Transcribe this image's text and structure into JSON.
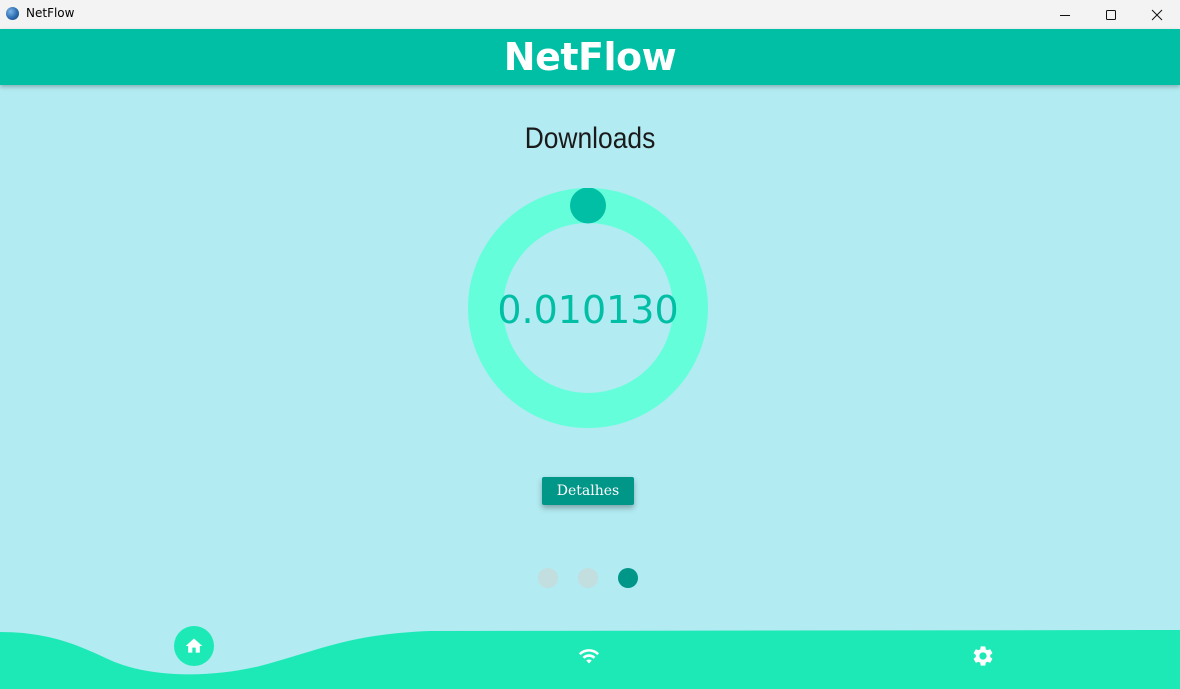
{
  "window": {
    "title": "NetFlow"
  },
  "header": {
    "title": "NetFlow"
  },
  "main": {
    "section_title": "Downloads",
    "value": "0.010130",
    "progress_fraction": 0.0,
    "details_button_label": "Detalhes",
    "pagination": {
      "total": 3,
      "active_index": 2
    }
  },
  "bottom_nav": {
    "items": [
      {
        "icon": "home-icon",
        "active": true
      },
      {
        "icon": "wifi-icon",
        "active": false
      },
      {
        "icon": "gear-icon",
        "active": false
      }
    ]
  },
  "colors": {
    "header": "#00bfa5",
    "background": "#b2ebf2",
    "gauge_track": "#64ffda",
    "gauge_knob": "#00bfa5",
    "button": "#009688",
    "nav_bar": "#1de9b6",
    "dot_inactive": "#c2dedf",
    "dot_active": "#009688"
  }
}
